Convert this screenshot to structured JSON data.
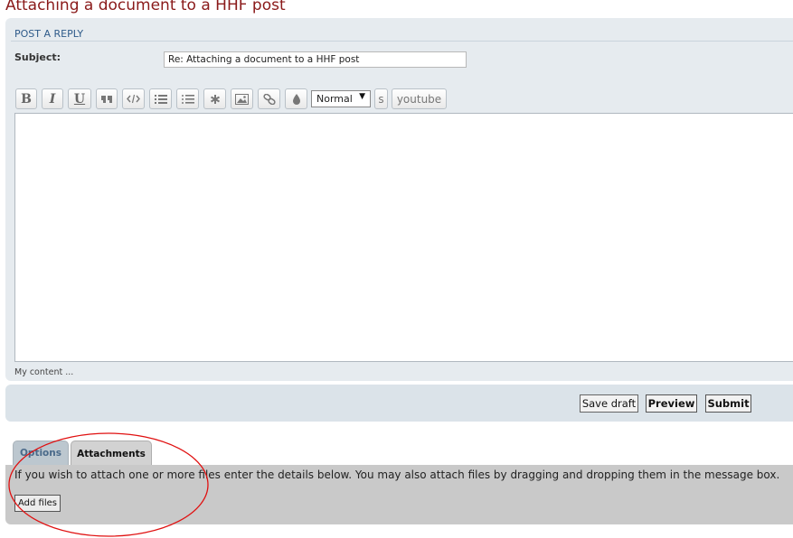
{
  "page": {
    "title": "Attaching a document to a HHF post"
  },
  "post": {
    "heading": "POST A REPLY",
    "subject_label": "Subject:",
    "subject_value": "Re: Attaching a document to a HHF post"
  },
  "toolbar": {
    "bold": "B",
    "italic": "I",
    "underline": "U",
    "font_size": "Normal",
    "strike": "s",
    "youtube": "youtube"
  },
  "editor": {
    "content": "",
    "hint": "My content ..."
  },
  "actions": {
    "save_draft": "Save draft",
    "preview": "Preview",
    "submit": "Submit"
  },
  "tabs": {
    "options": "Options",
    "attachments": "Attachments"
  },
  "attachments": {
    "info": "If you wish to attach one or more files enter the details below. You may also attach files by dragging and dropping them in the message box.",
    "add_files": "Add files"
  },
  "colors": {
    "title": "#8a1a1a",
    "heading": "#2f5b8a",
    "annotation": "#e01010"
  }
}
